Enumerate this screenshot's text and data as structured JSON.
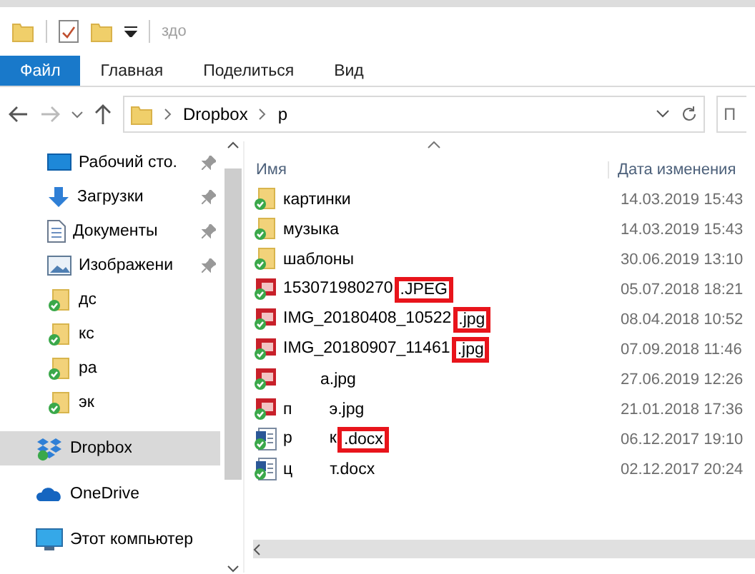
{
  "quick_access": {
    "title": "здо"
  },
  "ribbon": {
    "tabs": [
      {
        "label": "Файл",
        "selected": true
      },
      {
        "label": "Главная",
        "selected": false
      },
      {
        "label": "Поделиться",
        "selected": false
      },
      {
        "label": "Вид",
        "selected": false
      }
    ]
  },
  "address_bar": {
    "path": [
      "Dropbox",
      "р"
    ],
    "search_placeholder": "П"
  },
  "nav_pane": {
    "items": [
      {
        "label": "Рабочий сто.",
        "kind": "desktop",
        "pinned": true,
        "selected": false
      },
      {
        "label": "Загрузки",
        "kind": "downloads",
        "pinned": true,
        "selected": false
      },
      {
        "label": "Документы",
        "kind": "documents",
        "pinned": true,
        "selected": false
      },
      {
        "label": "Изображени",
        "kind": "pictures",
        "pinned": true,
        "selected": false
      },
      {
        "label": "дс",
        "kind": "folder",
        "pinned": false,
        "selected": false
      },
      {
        "label": "кс",
        "kind": "folder",
        "pinned": false,
        "selected": false
      },
      {
        "label": "ра",
        "kind": "folder",
        "pinned": false,
        "selected": false
      },
      {
        "label": "эк",
        "kind": "folder",
        "pinned": false,
        "selected": false
      },
      {
        "label": "Dropbox",
        "kind": "dropbox",
        "pinned": false,
        "selected": true
      },
      {
        "label": "OneDrive",
        "kind": "onedrive",
        "pinned": false,
        "selected": false
      },
      {
        "label": "Этот компьютер",
        "kind": "computer",
        "pinned": false,
        "selected": false
      }
    ]
  },
  "file_list": {
    "columns": [
      "Имя",
      "Дата изменения"
    ],
    "rows": [
      {
        "kind": "folder",
        "blurred": false,
        "name_parts": [
          {
            "text": "картинки",
            "highlighted": false
          }
        ],
        "date": "14.03.2019 15:43"
      },
      {
        "kind": "folder",
        "blurred": false,
        "name_parts": [
          {
            "text": "музыка",
            "highlighted": false
          }
        ],
        "date": "14.03.2019 15:43"
      },
      {
        "kind": "folder",
        "blurred": false,
        "name_parts": [
          {
            "text": "шаблоны",
            "highlighted": false
          }
        ],
        "date": "30.06.2019 13:10"
      },
      {
        "kind": "image",
        "blurred": false,
        "name_parts": [
          {
            "text": "153071980270",
            "highlighted": false
          },
          {
            "text": ".JPEG",
            "highlighted": true
          }
        ],
        "date": "05.07.2018 18:21"
      },
      {
        "kind": "image",
        "blurred": false,
        "name_parts": [
          {
            "text": "IMG_20180408_10522",
            "highlighted": false
          },
          {
            "text": ".jpg",
            "highlighted": true
          }
        ],
        "date": "08.04.2018 10:52"
      },
      {
        "kind": "image",
        "blurred": false,
        "name_parts": [
          {
            "text": "IMG_20180907_11461",
            "highlighted": false
          },
          {
            "text": ".jpg",
            "highlighted": true
          }
        ],
        "date": "07.09.2018 11:46"
      },
      {
        "kind": "image",
        "blurred": true,
        "name_parts": [
          {
            "text": "а.jpg",
            "highlighted": false
          }
        ],
        "date": "27.06.2019 12:26"
      },
      {
        "kind": "image",
        "blurred": true,
        "name_parts": [
          {
            "text": "п",
            "highlighted": false
          },
          {
            "text": "э.jpg",
            "highlighted": false
          }
        ],
        "date": "21.01.2018 17:36"
      },
      {
        "kind": "document",
        "blurred": true,
        "name_parts": [
          {
            "text": "р",
            "highlighted": false
          },
          {
            "text": "к",
            "highlighted": false
          },
          {
            "text": ".docx",
            "highlighted": true
          }
        ],
        "date": "06.12.2017 19:10"
      },
      {
        "kind": "document",
        "blurred": true,
        "name_parts": [
          {
            "text": "ц",
            "highlighted": false
          },
          {
            "text": "т.docx",
            "highlighted": false
          }
        ],
        "date": "02.12.2017 20:24"
      }
    ]
  }
}
